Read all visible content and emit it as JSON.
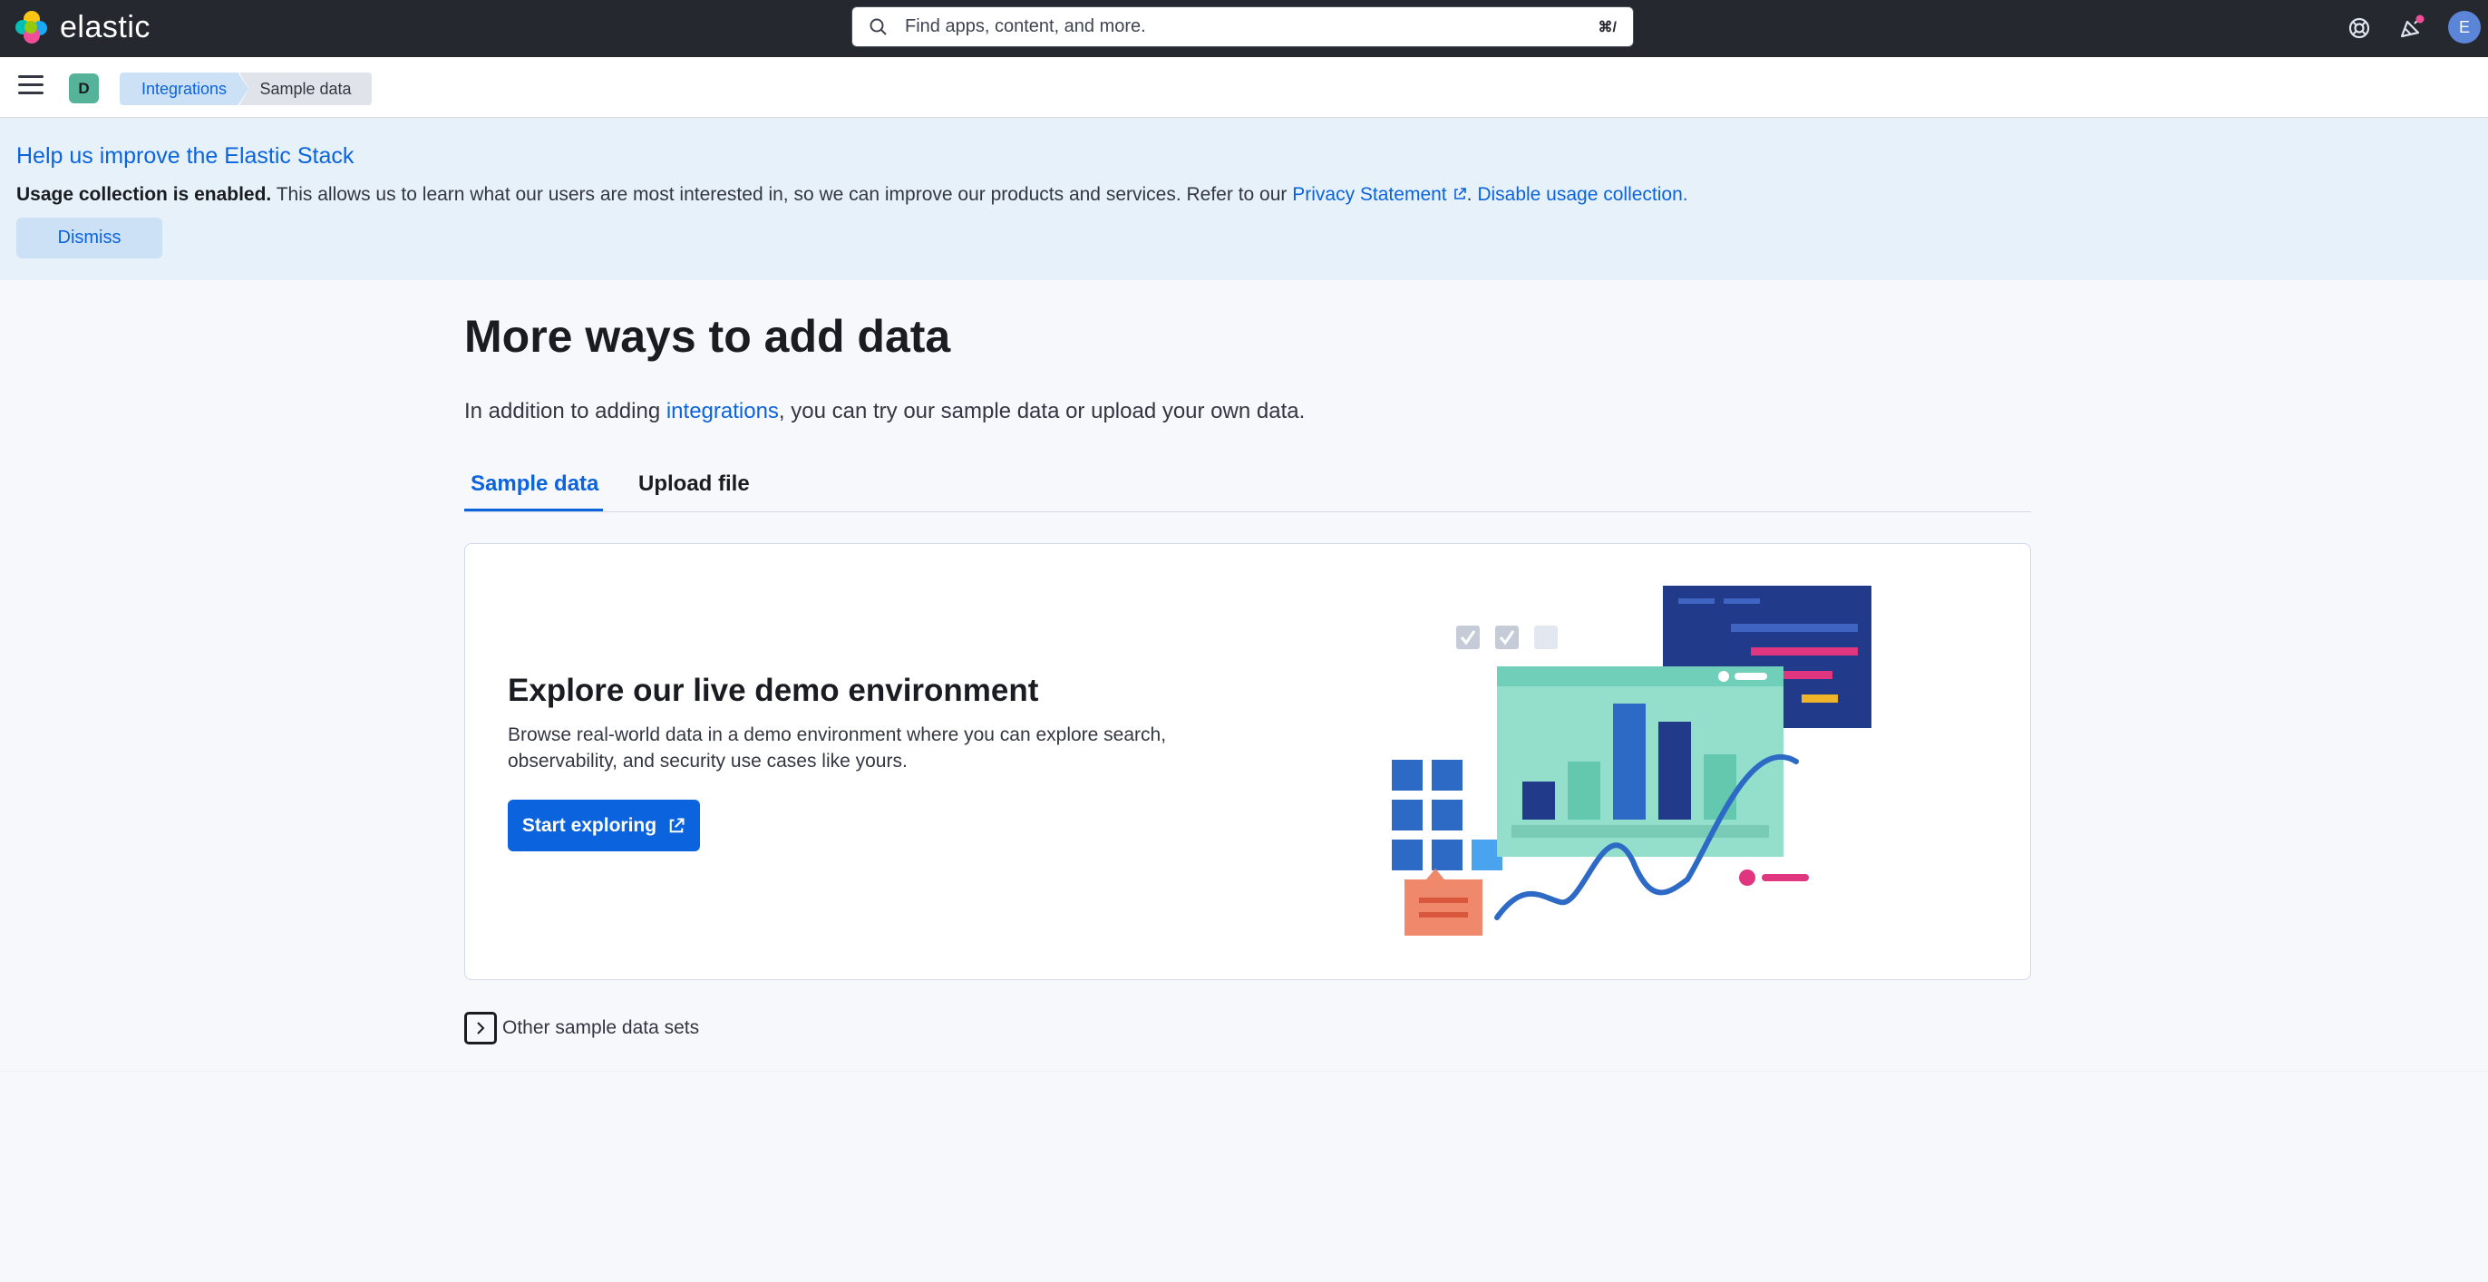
{
  "header": {
    "brand": "elastic",
    "search_placeholder": "Find apps, content, and more.",
    "search_shortcut": "⌘/",
    "user_initial": "E"
  },
  "subbar": {
    "space_initial": "D",
    "breadcrumbs": [
      "Integrations",
      "Sample data"
    ]
  },
  "callout": {
    "title": "Help us improve the Elastic Stack",
    "text_bold": "Usage collection is enabled.",
    "text_body": " This allows us to learn what our users are most interested in, so we can improve our products and services. Refer to our ",
    "privacy_link": "Privacy Statement",
    "separator": ". ",
    "disable_link": "Disable usage collection.",
    "dismiss_label": "Dismiss"
  },
  "main": {
    "title": "More ways to add data",
    "intro_before": "In addition to adding ",
    "intro_link": "integrations",
    "intro_after": ", you can try our sample data or upload your own data.",
    "tabs": [
      {
        "label": "Sample data",
        "active": true
      },
      {
        "label": "Upload file",
        "active": false
      }
    ],
    "panel": {
      "title": "Explore our live demo environment",
      "description": "Browse real-world data in a demo environment where you can explore search, observability, and security use cases like yours.",
      "button_label": "Start exploring"
    },
    "other_sets_label": "Other sample data sets"
  },
  "colors": {
    "accent": "#0b64dd",
    "header_bg": "#25282f",
    "callout_bg": "#e6f1fa"
  }
}
